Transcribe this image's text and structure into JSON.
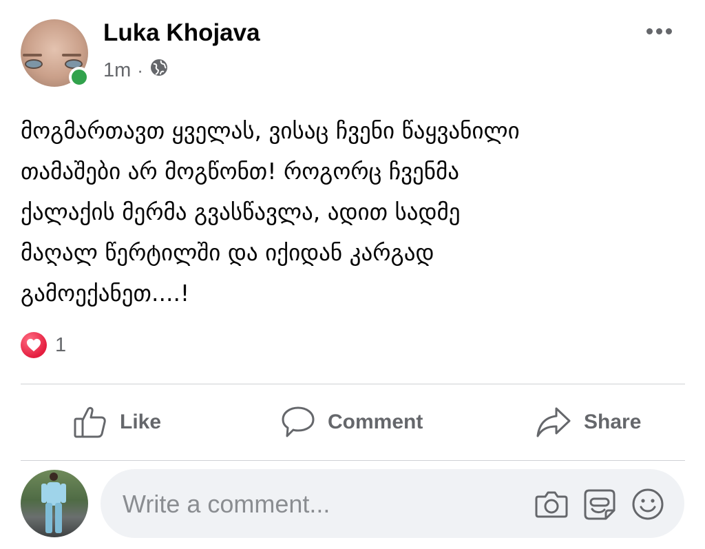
{
  "post": {
    "author": "Luka Khojava",
    "timestamp": "1m",
    "separator": "·",
    "audience_icon": "globe-icon",
    "text": "მოგმართავთ ყველას, ვისაც ჩვენი წაყვანილი\nთამაშები არ მოგწონთ! როგორც ჩვენმა\nქალაქის მერმა გვასწავლა, ადით სადმე\nმაღალ წერტილში და იქიდან კარგად\nგამოექანეთ....!",
    "reaction_icon": "heart-icon",
    "reaction_count": "1"
  },
  "actions": {
    "like_label": "Like",
    "comment_label": "Comment",
    "share_label": "Share"
  },
  "composer": {
    "placeholder": "Write a comment...",
    "icons": [
      "camera-icon",
      "gif-sticker-icon",
      "emoji-icon"
    ]
  },
  "colors": {
    "text": "#050505",
    "secondary": "#65676b",
    "online": "#31a24c",
    "love": "#e41e3f",
    "input_bg": "#f0f2f5",
    "divider": "#ced0d4"
  }
}
